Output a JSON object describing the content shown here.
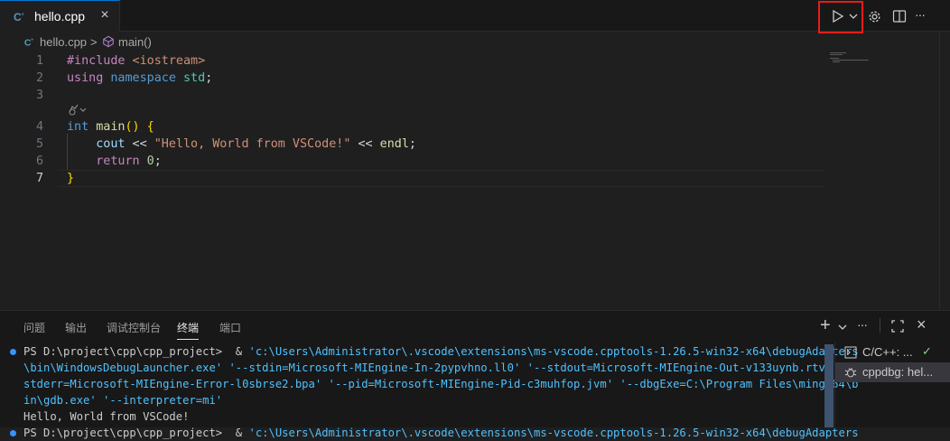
{
  "tab": {
    "title": "hello.cpp",
    "close": "×"
  },
  "breadcrumb": {
    "file": "hello.cpp",
    "separator": ">",
    "symbol": "main()"
  },
  "toolbar": {
    "run_icon": "play-icon",
    "dropdown_icon": "chevron-down-icon",
    "settings_icon": "gear-icon",
    "split_icon": "split-editor-icon",
    "more_icon": "more-icon",
    "more": "···"
  },
  "editor": {
    "line_numbers": [
      "1",
      "2",
      "3",
      "4",
      "5",
      "6",
      "7"
    ],
    "lines": {
      "l1_directive": "#include",
      "l1_header": " <iostream>",
      "l2_using": "using",
      "l2_namespace": " namespace",
      "l2_std": " std",
      "l2_semicolon": ";",
      "l4_int": "int",
      "l4_main": " main",
      "l4_parens": "()",
      "l4_brace": " {",
      "l5_indent": "    ",
      "l5_cout": "cout",
      "l5_op": " << ",
      "l5_string": "\"Hello, World from VSCode!\"",
      "l5_op2": " << ",
      "l5_endl": "endl",
      "l5_semi": ";",
      "l6_indent": "    ",
      "l6_return": "return",
      "l6_zero": " 0",
      "l6_semi": ";",
      "l7_brace": "}"
    }
  },
  "panel": {
    "tabs": [
      "问题",
      "输出",
      "调试控制台",
      "终端",
      "端口"
    ],
    "active_tab": "终端",
    "actions": {
      "new": "+",
      "maximize": "⛶",
      "close": "×"
    }
  },
  "terminal": {
    "line1_prompt": "PS D:\\project\\cpp\\cpp_project>  & ",
    "line1_path": "'c:\\Users\\Administrator\\.vscode\\extensions\\ms-vscode.cpptools-1.26.5-win32-x64\\debugAdapters",
    "line2": "\\bin\\WindowsDebugLauncher.exe' '--stdin=Microsoft-MIEngine-In-2pypvhno.ll0' '--stdout=Microsoft-MIEngine-Out-v133uynb.rtv' '--",
    "line3": "stderr=Microsoft-MIEngine-Error-l0sbrse2.bpa' '--pid=Microsoft-MIEngine-Pid-c3muhfop.jvm' '--dbgExe=C:\\Program Files\\mingw64\\b",
    "line4": "in\\gdb.exe' '--interpreter=mi'",
    "line5": "Hello, World from VSCode!",
    "line6_prompt": "PS D:\\project\\cpp\\cpp_project>  & ",
    "line6_path": "'c:\\Users\\Administrator\\.vscode\\extensions\\ms-vscode.cpptools-1.26.5-win32-x64\\debugAdapters"
  },
  "terminal_list": [
    {
      "label": "C/C++: ...",
      "status": "✓"
    },
    {
      "label": "cppdbg: hel..."
    }
  ],
  "colors": {
    "accent": "#0078d4",
    "highlight_border": "#e51c1c"
  }
}
